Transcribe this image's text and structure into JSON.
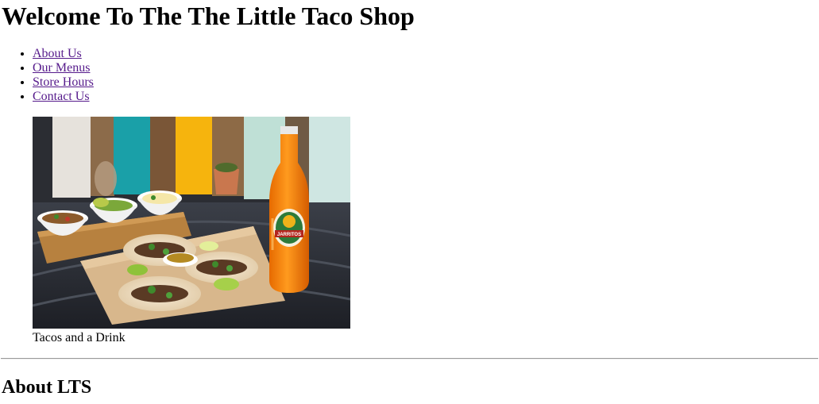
{
  "page": {
    "title": "Welcome To The The Little Taco Shop"
  },
  "nav": {
    "items": [
      {
        "label": "About Us"
      },
      {
        "label": "Our Menus"
      },
      {
        "label": "Store Hours"
      },
      {
        "label": "Contact Us"
      }
    ]
  },
  "figure": {
    "image_subject": "tacos with salsas and an orange Jarritos bottle",
    "caption": "Tacos and a Drink",
    "bottle_label": "JARRITOS"
  },
  "about": {
    "heading": "About LTS"
  },
  "colors": {
    "link": "#551a8b",
    "text": "#000000",
    "background": "#ffffff"
  }
}
